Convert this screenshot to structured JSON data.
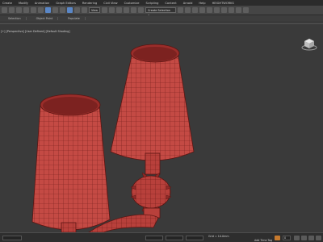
{
  "menu": [
    "Create",
    "Modify",
    "Animation",
    "Graph Editors",
    "Rendering",
    "Civil View",
    "Customize",
    "Scripting",
    "Content",
    "Arnold",
    "Help",
    "HEIGHTWORKS"
  ],
  "toolbar": {
    "selection_set": "Create Selection Se",
    "view_label": "View"
  },
  "subbar": {
    "tabs": [
      "Selection",
      "Object Paint",
      "Populate"
    ]
  },
  "viewport": {
    "label": "[+] [Perspective] [User Defined] [Default Shading]"
  },
  "status": {
    "grid": "Grid = 10.0mm",
    "add_time_tag": "Add Time Tag",
    "frame": "0",
    "auto_key_text": "Auto Key",
    "selected_label": "Selected"
  },
  "colors": {
    "background": "#3a3a3a",
    "mesh": "#c44a44",
    "mesh_dark": "#8f2a28",
    "wire": "#5b1512",
    "accent": "#5a87c7"
  }
}
